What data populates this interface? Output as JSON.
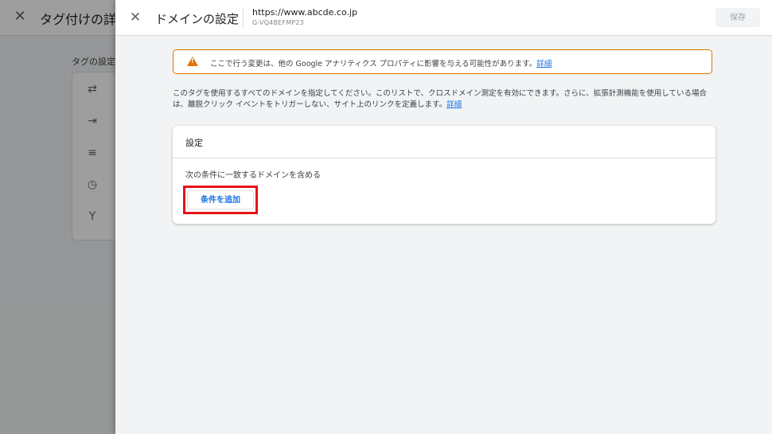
{
  "background": {
    "title": "タグ付けの詳細",
    "section_label": "タグの設定",
    "icons": [
      "arrows-icon",
      "login-icon",
      "filter-icon",
      "clock-icon",
      "fork-icon"
    ]
  },
  "drawer": {
    "title": "ドメインの設定",
    "url": "https://www.abcde.co.jp",
    "stream_id": "G-VQ4BEFMP23",
    "save_label": "保存",
    "warning": {
      "text": "ここで行う変更は、他の Google アナリティクス プロパティに影響を与える可能性があります。",
      "link": "詳細"
    },
    "description": {
      "text": "このタグを使用するすべてのドメインを指定してください。このリストで、クロスドメイン測定を有効にできます。さらに、拡張計測機能を使用している場合は、離脱クリック イベントをトリガーしない、サイト上のリンクを定義します。",
      "link": "詳細"
    },
    "card": {
      "title": "設定",
      "rule": "次の条件に一致するドメインを含める",
      "add_label": "条件を追加"
    }
  },
  "colors": {
    "accent": "#1a73e8",
    "warning": "#e37400",
    "highlight": "#e8111a"
  }
}
